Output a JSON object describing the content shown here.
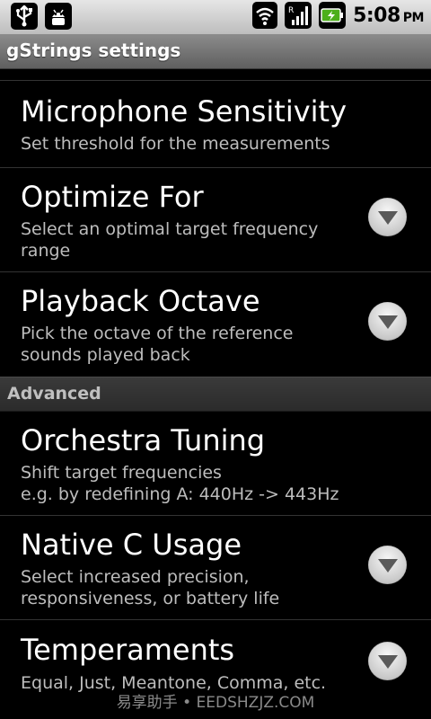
{
  "status_bar": {
    "icons_left": [
      "usb-icon",
      "android-debug-icon"
    ],
    "icons_right": [
      "wifi-icon",
      "signal-roaming-icon",
      "battery-charging-icon"
    ],
    "time": "5:08",
    "ampm": "PM"
  },
  "title_bar": {
    "title": "gStrings settings"
  },
  "prefs": [
    {
      "title": "Microphone Sensitivity",
      "summary": "Set threshold for the measurements"
    },
    {
      "title": "Optimize For",
      "summary": "Select an optimal target frequency range"
    },
    {
      "title": "Playback Octave",
      "summary": "Pick the octave of the reference sounds played back"
    },
    {
      "title": "Orchestra Tuning",
      "summary_line1": "Shift target frequencies",
      "summary_line2": "e.g. by redefining A: 440Hz -> 443Hz"
    },
    {
      "title": "Native C Usage",
      "summary": "Select increased precision, responsiveness, or battery life"
    },
    {
      "title": "Temperaments",
      "summary": "Equal, Just, Meantone, Comma, etc."
    }
  ],
  "category": {
    "label": "Advanced"
  },
  "watermark": "易享助手 • EEDSHZJZ.COM",
  "colors": {
    "background": "#000000",
    "summary_text": "#bdbdbd",
    "category_text": "#c0c0c0"
  }
}
